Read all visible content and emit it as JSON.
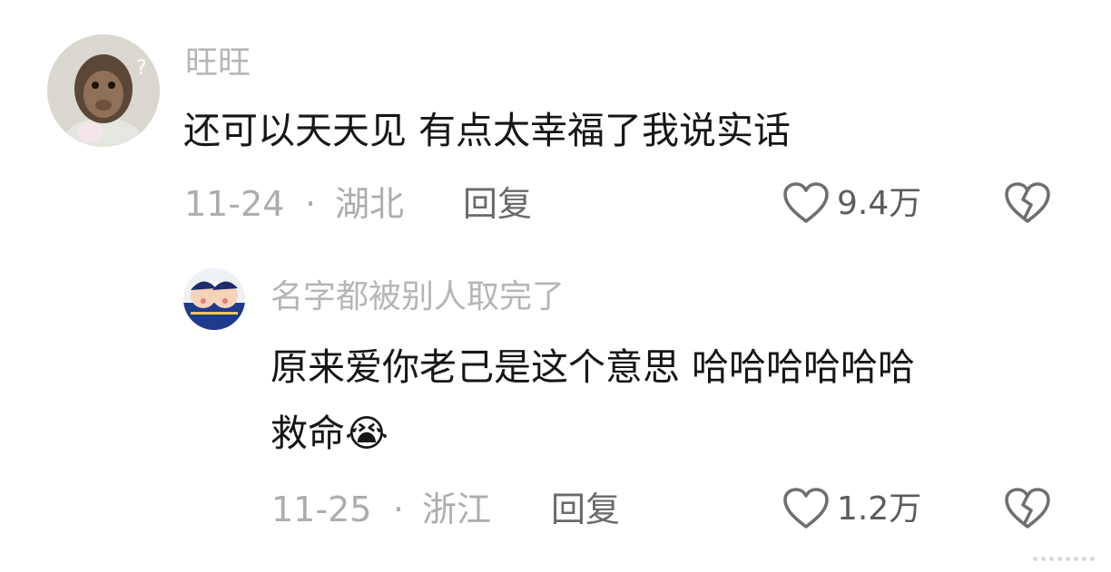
{
  "comments": [
    {
      "username": "旺旺",
      "text": "还可以天天见 有点太幸福了我说实话",
      "date": "11-24",
      "separator": "·",
      "location": "湖北",
      "reply_label": "回复",
      "likes": "9.4万",
      "avatar_icon": "monkey-avatar-icon"
    },
    {
      "username": "名字都被别人取完了",
      "text_line1": "原来爱你老己是这个意思 哈哈哈哈哈哈",
      "text_line2": "救命",
      "emoji": "😭",
      "date": "11-25",
      "separator": "·",
      "location": "浙江",
      "reply_label": "回复",
      "likes": "1.2万",
      "avatar_icon": "cartoon-avatar-icon"
    }
  ],
  "colors": {
    "username": "#b6b6b6",
    "text": "#161616",
    "meta": "#adadad",
    "icon": "#6f6f6f"
  }
}
